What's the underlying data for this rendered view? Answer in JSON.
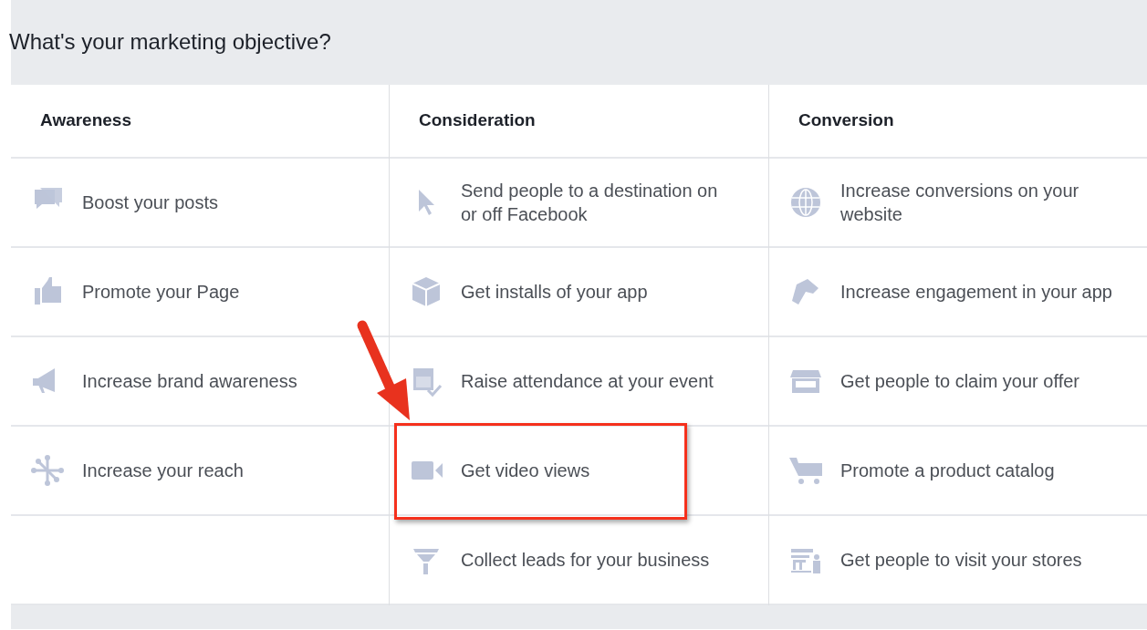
{
  "title": "What's your marketing objective?",
  "columns": [
    {
      "heading": "Awareness",
      "items": [
        {
          "label": "Boost your posts",
          "highlighted": false
        },
        {
          "label": "Promote your Page",
          "highlighted": false
        },
        {
          "label": "Increase brand awareness",
          "highlighted": false
        },
        {
          "label": "Increase your reach",
          "highlighted": false
        }
      ]
    },
    {
      "heading": "Consideration",
      "items": [
        {
          "label": "Send people to a destination on or off Facebook",
          "highlighted": false
        },
        {
          "label": "Get installs of your app",
          "highlighted": false
        },
        {
          "label": "Raise attendance at your event",
          "highlighted": false
        },
        {
          "label": "Get video views",
          "highlighted": true
        },
        {
          "label": "Collect leads for your business",
          "highlighted": false
        }
      ]
    },
    {
      "heading": "Conversion",
      "items": [
        {
          "label": "Increase conversions on your website",
          "highlighted": false
        },
        {
          "label": "Increase engagement in your app",
          "highlighted": false
        },
        {
          "label": "Get people to claim your offer",
          "highlighted": false
        },
        {
          "label": "Promote a product catalog",
          "highlighted": false
        },
        {
          "label": "Get people to visit your stores",
          "highlighted": false
        }
      ]
    }
  ]
}
